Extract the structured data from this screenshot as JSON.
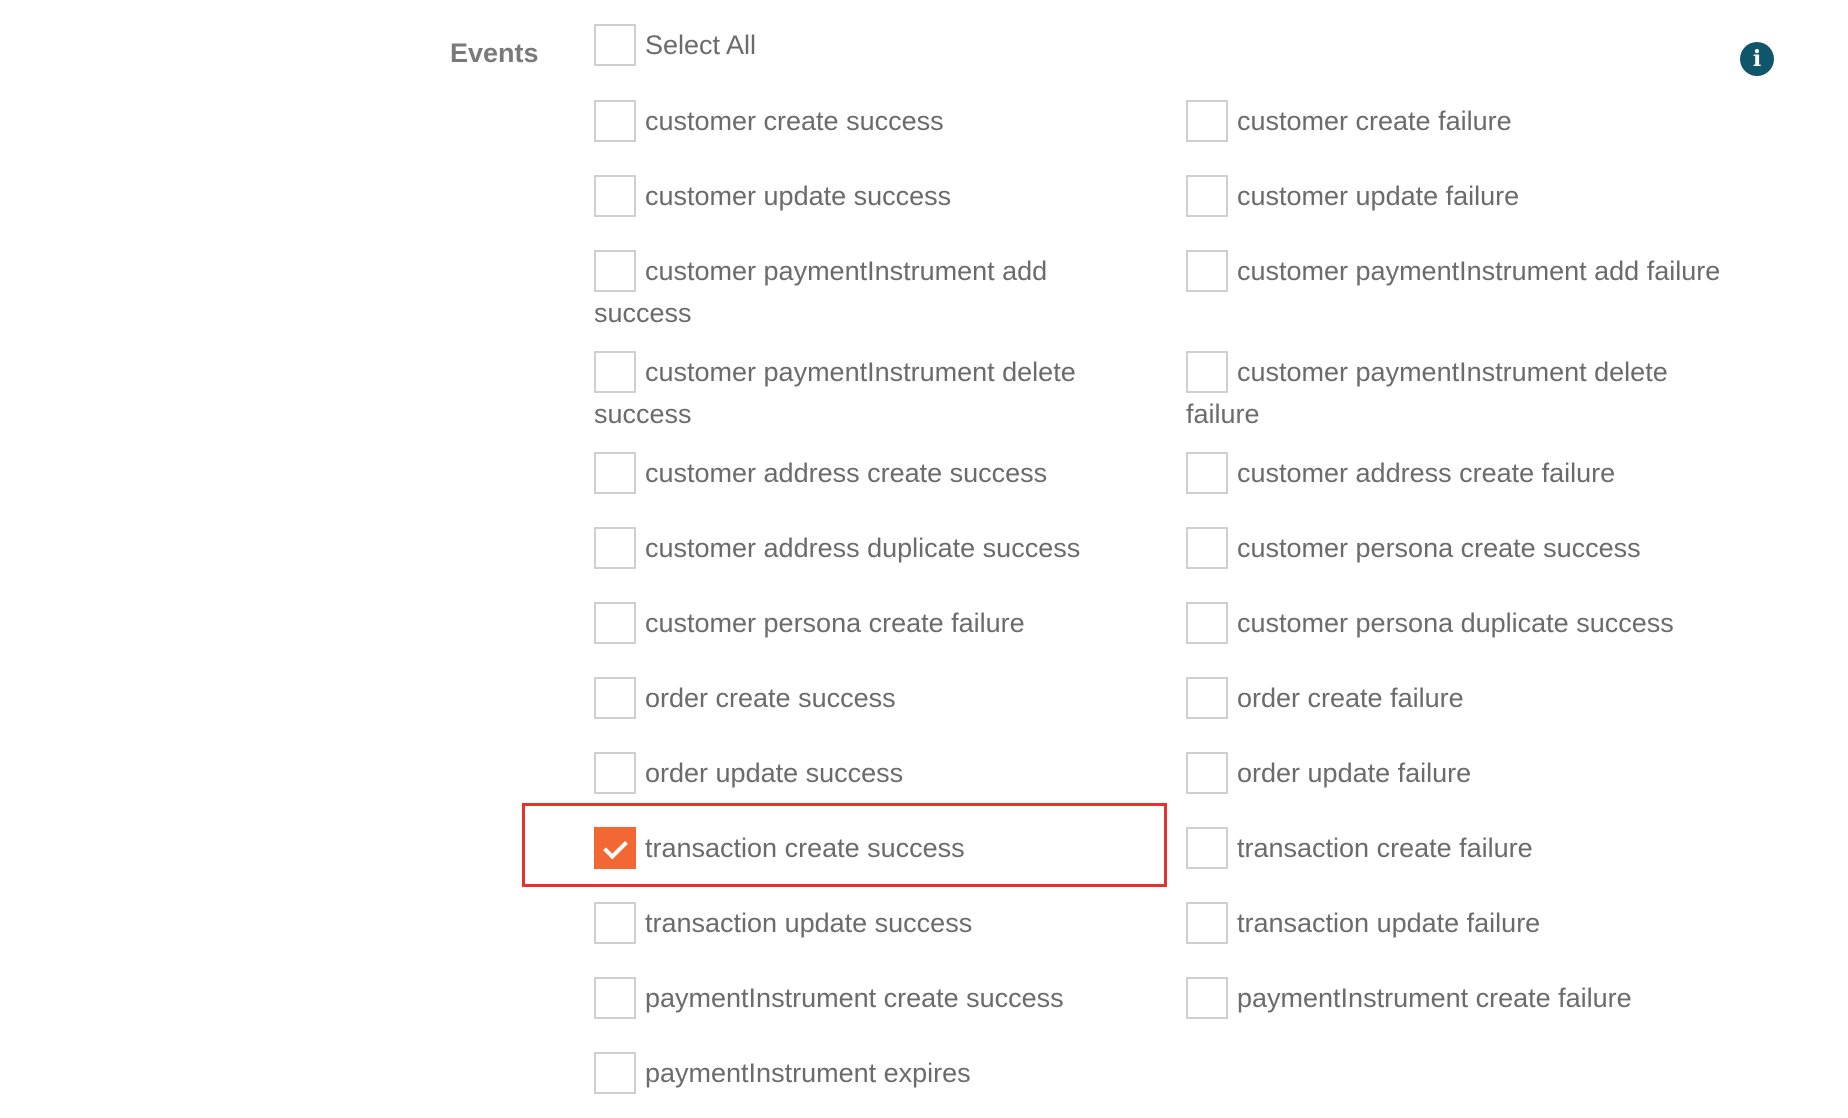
{
  "section": {
    "label": "Events",
    "info_icon": "info-icon"
  },
  "colors": {
    "checkbox_checked": "#f26732",
    "highlight_border": "#e5322d",
    "info_icon_bg": "#10566b",
    "text": "#6b6b6b"
  },
  "select_all": {
    "label": "Select All",
    "checked": false
  },
  "events_left": [
    {
      "label": "customer create success",
      "checked": false
    },
    {
      "label": "customer update success",
      "checked": false
    },
    {
      "label": "customer paymentInstrument add success",
      "checked": false
    },
    {
      "label": "customer paymentInstrument delete success",
      "checked": false
    },
    {
      "label": "customer address create success",
      "checked": false
    },
    {
      "label": "customer address duplicate success",
      "checked": false
    },
    {
      "label": "customer persona create failure",
      "checked": false
    },
    {
      "label": "order create success",
      "checked": false
    },
    {
      "label": "order update success",
      "checked": false
    },
    {
      "label": "transaction create success",
      "checked": true
    },
    {
      "label": "transaction update success",
      "checked": false
    },
    {
      "label": "paymentInstrument create success",
      "checked": false
    },
    {
      "label": "paymentInstrument expires",
      "checked": false
    }
  ],
  "events_right": [
    {
      "label": "customer create failure",
      "checked": false
    },
    {
      "label": "customer update failure",
      "checked": false
    },
    {
      "label": "customer paymentInstrument add failure",
      "checked": false
    },
    {
      "label": "customer paymentInstrument delete failure",
      "checked": false
    },
    {
      "label": "customer address create failure",
      "checked": false
    },
    {
      "label": "customer persona create success",
      "checked": false
    },
    {
      "label": "customer persona duplicate success",
      "checked": false
    },
    {
      "label": "order create failure",
      "checked": false
    },
    {
      "label": "order update failure",
      "checked": false
    },
    {
      "label": "transaction create failure",
      "checked": false
    },
    {
      "label": "transaction update failure",
      "checked": false
    },
    {
      "label": "paymentInstrument create failure",
      "checked": false
    }
  ]
}
